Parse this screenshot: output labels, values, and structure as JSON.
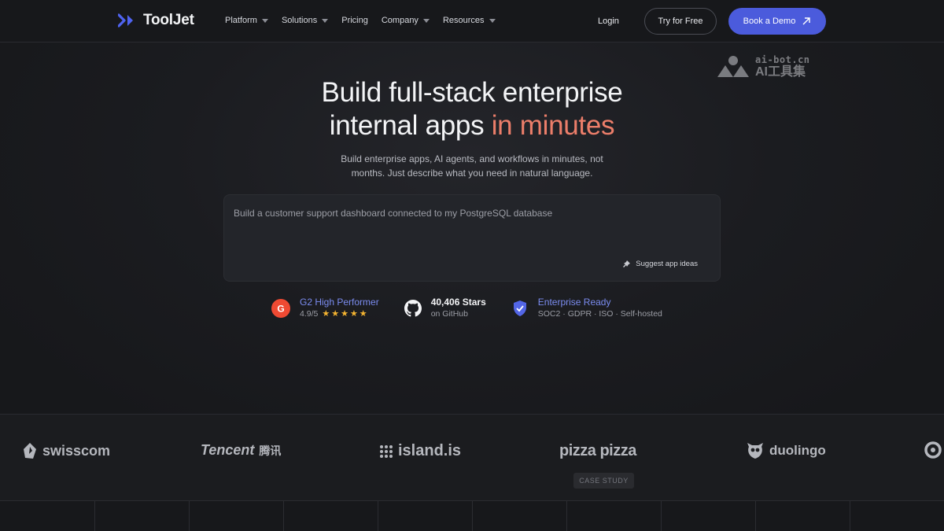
{
  "nav": {
    "logo_text": "ToolJet",
    "links": [
      {
        "label": "Platform",
        "dropdown": true
      },
      {
        "label": "Solutions",
        "dropdown": true
      },
      {
        "label": "Pricing",
        "dropdown": false
      },
      {
        "label": "Company",
        "dropdown": true
      },
      {
        "label": "Resources",
        "dropdown": true
      }
    ],
    "login": "Login",
    "try_free": "Try for Free",
    "book_demo": "Book a Demo"
  },
  "watermark": {
    "top": "ai-bot.cn",
    "bottom": "AI工具集"
  },
  "hero": {
    "title_line1": "Build full-stack enterprise",
    "title_line2_plain": "internal apps ",
    "title_line2_accent": "in minutes",
    "subtitle_line1": "Build enterprise apps, AI agents, and workflows in minutes, not",
    "subtitle_line2": "months. Just describe what you need in natural language."
  },
  "prompt": {
    "placeholder": "Build a customer support dashboard connected to my PostgreSQL database",
    "suggest_label": "Suggest app ideas"
  },
  "badges": {
    "g2": {
      "title": "G2 High Performer",
      "rating": "4.9/5",
      "stars": "★★★★★"
    },
    "github": {
      "title": "40,406 Stars",
      "sub": "on GitHub"
    },
    "enterprise": {
      "title": "Enterprise Ready",
      "sub": "SOC2 · GDPR · ISO · Self-hosted"
    }
  },
  "customers": {
    "logos": [
      "swisscom",
      "Tencent",
      "腾讯",
      "island.is",
      "pizza pizza",
      "duolingo"
    ],
    "case_study": "CASE STUDY"
  },
  "colors": {
    "accent_title": "#ec7e6a",
    "primary_button": "#4b5bdc",
    "badge_link": "#7b8cf0",
    "star": "#f5b431",
    "g2_red": "#ef4a33"
  }
}
